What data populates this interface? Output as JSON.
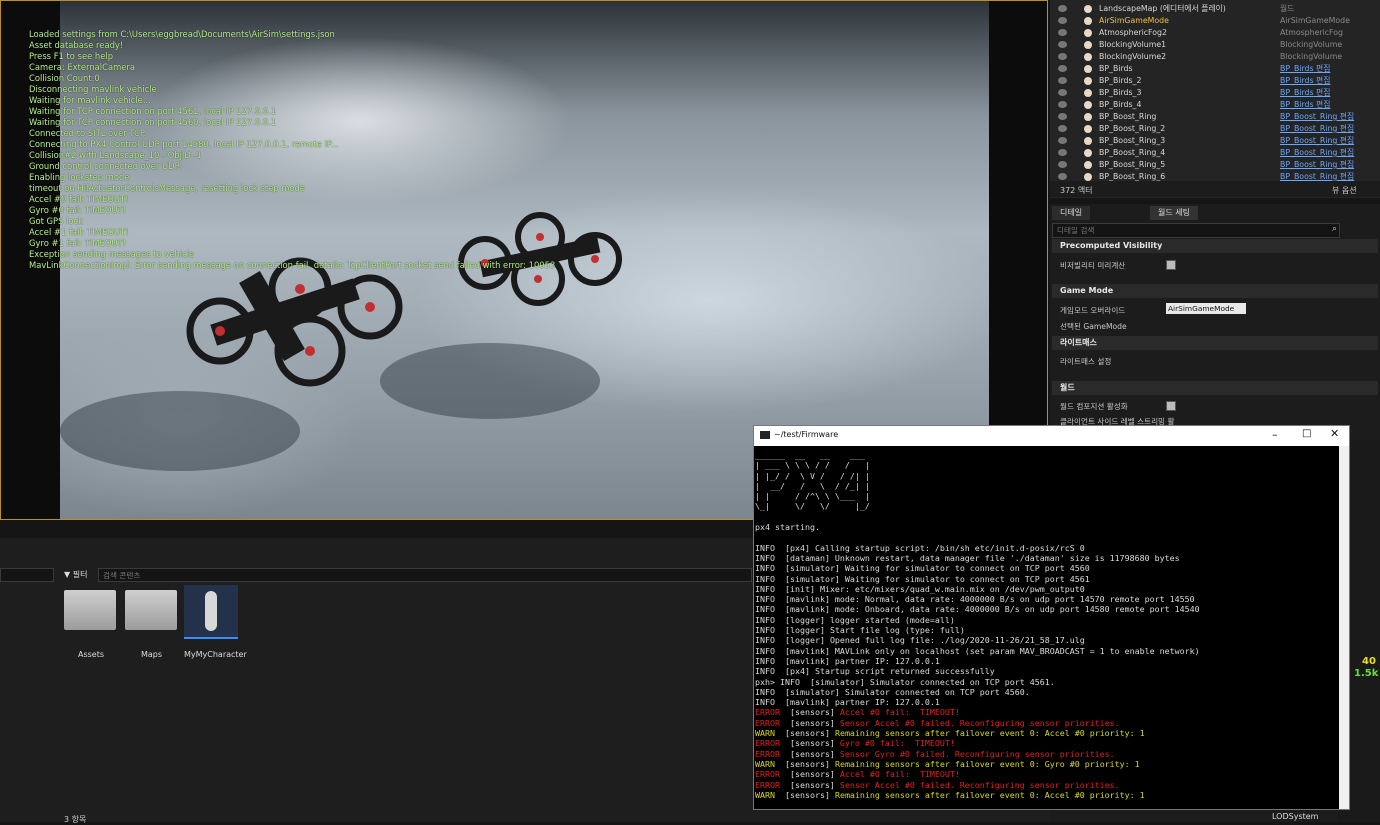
{
  "viewport": {
    "log_lines": [
      "Loaded settings from C:\\Users\\eggbread\\Documents\\AirSim\\settings.json",
      "Asset database ready!",
      "Press F1 to see help",
      "Camera: ExternalCamera",
      "Collision Count:0",
      "Disconnecting mavlink vehicle",
      "Waiting for mavlink vehicle...",
      "Waiting for TCP connection on port 4561, local IP 127.0.0.1",
      "Waiting for TCP connection on port 4560, local IP 127.0.0.1",
      "Connected to SITL over TCP.",
      "Connecting to PX4 Control UDP port 14580, local IP 127.0.0.1, remote IP...",
      "Collision#2 with Landscape_10 - ObjID -1",
      "Ground control connected over UDP.",
      "Enabling lockstep mode",
      "timeout on HilActuatorControlsMessage, resetting lock step mode",
      "Accel #0 fail:  TIMEOUT!",
      "Gyro #0 fail:  TIMEOUT!",
      "Got GPS lock",
      "Accel #1 fail:  TIMEOUT!",
      "Gyro #1 fail:  TIMEOUT!",
      "Exception sending messages to vehicle",
      "MavLinkConnectionImpl: Error sending message on connection fail, details: TcpClientPort socket send failed with error: 10053"
    ]
  },
  "outliner": {
    "rows": [
      {
        "name": "LandscapeMap (에디터에서 플레이)",
        "type": "월드",
        "link": false
      },
      {
        "name": "AirSimGameMode",
        "type": "AirSimGameMode",
        "link": false
      },
      {
        "name": "AtmosphericFog2",
        "type": "AtmosphericFog",
        "link": false
      },
      {
        "name": "BlockingVolume1",
        "type": "BlockingVolume",
        "link": false
      },
      {
        "name": "BlockingVolume2",
        "type": "BlockingVolume",
        "link": false
      },
      {
        "name": "BP_Birds",
        "type": "BP_Birds 편집",
        "link": true
      },
      {
        "name": "BP_Birds_2",
        "type": "BP_Birds 편집",
        "link": true
      },
      {
        "name": "BP_Birds_3",
        "type": "BP_Birds 편집",
        "link": true
      },
      {
        "name": "BP_Birds_4",
        "type": "BP_Birds 편집",
        "link": true
      },
      {
        "name": "BP_Boost_Ring",
        "type": "BP_Boost_Ring 편집",
        "link": true
      },
      {
        "name": "BP_Boost_Ring_2",
        "type": "BP_Boost_Ring 편집",
        "link": true
      },
      {
        "name": "BP_Boost_Ring_3",
        "type": "BP_Boost_Ring 편집",
        "link": true
      },
      {
        "name": "BP_Boost_Ring_4",
        "type": "BP_Boost_Ring 편집",
        "link": true
      },
      {
        "name": "BP_Boost_Ring_5",
        "type": "BP_Boost_Ring 편집",
        "link": true
      },
      {
        "name": "BP_Boost_Ring_6",
        "type": "BP_Boost_Ring 편집",
        "link": true
      }
    ],
    "actor_count": "372 액터",
    "view_options": "뷰 옵션"
  },
  "details": {
    "tab_details": "디테일",
    "tab_world": "월드 세팅",
    "search_placeholder": "디테일 검색",
    "sec_precomputed": "Precomputed Visibility",
    "prop_visibility": "비저빌리티 미리계산",
    "sec_gamemode": "Game Mode",
    "prop_gamemode_override": "게임모드 오버라이드",
    "gamemode_value": "AirSimGameMode",
    "prop_selected_gamemode": "선택된 GameMode",
    "sec_lightmass": "라이트매스",
    "prop_lightmass_settings": "라이트매스 설정",
    "sec_world": "월드",
    "prop_world_composition": "월드 컴포지션 활성화",
    "prop_client_streaming": "클라이언트 사이드 레벨 스트리밍 활",
    "lod_label": "LODSystem",
    "view_options": "뷰 옵션"
  },
  "content_browser": {
    "filter_label": "필터",
    "search_placeholder": "검색 콘텐츠",
    "assets": [
      "Assets",
      "Maps",
      "MyMyCharacter"
    ],
    "item_count": "3 항목"
  },
  "console": {
    "title": "~/test/Firmware",
    "banner": [
      "______  __   __    ___ ",
      "| ___ \\ \\ \\ / /   /   |",
      "| |_/ /  \\ V /   / /| |",
      "|  __/   /   \\  / /_| |",
      "| |     / /^\\ \\ \\___  |",
      "\\_|     \\/   \\/     |_/"
    ],
    "starting": "px4 starting.",
    "lines": [
      {
        "lv": "INFO",
        "cls": "ok",
        "text": "[px4] Calling startup script: /bin/sh etc/init.d-posix/rcS 0"
      },
      {
        "lv": "INFO",
        "cls": "ok",
        "text": "[dataman] Unknown restart, data manager file './dataman' size is 11798680 bytes"
      },
      {
        "lv": "INFO",
        "cls": "ok",
        "text": "[simulator] Waiting for simulator to connect on TCP port 4560"
      },
      {
        "lv": "INFO",
        "cls": "ok",
        "text": "[simulator] Waiting for simulator to connect on TCP port 4561"
      },
      {
        "lv": "INFO",
        "cls": "ok",
        "text": "[init] Mixer: etc/mixers/quad_w.main.mix on /dev/pwm_output0"
      },
      {
        "lv": "INFO",
        "cls": "ok",
        "text": "[mavlink] mode: Normal, data rate: 4000000 B/s on udp port 14570 remote port 14550"
      },
      {
        "lv": "INFO",
        "cls": "ok",
        "text": "[mavlink] mode: Onboard, data rate: 4000000 B/s on udp port 14580 remote port 14540"
      },
      {
        "lv": "INFO",
        "cls": "ok",
        "text": "[logger] logger started (mode=all)"
      },
      {
        "lv": "INFO",
        "cls": "ok",
        "text": "[logger] Start file log (type: full)"
      },
      {
        "lv": "INFO",
        "cls": "ok",
        "text": "[logger] Opened full log file: ./log/2020-11-26/21_58_17.ulg"
      },
      {
        "lv": "INFO",
        "cls": "ok",
        "text": "[mavlink] MAVLink only on localhost (set param MAV_BROADCAST = 1 to enable network)"
      },
      {
        "lv": "INFO",
        "cls": "ok",
        "text": "[mavlink] partner IP: 127.0.0.1"
      },
      {
        "lv": "INFO",
        "cls": "ok",
        "text": "[px4] Startup script returned successfully"
      },
      {
        "lv": "pxh> INFO",
        "cls": "ok",
        "text": "[simulator] Simulator connected on TCP port 4561."
      },
      {
        "lv": "INFO",
        "cls": "ok",
        "text": "[simulator] Simulator connected on TCP port 4560."
      },
      {
        "lv": "INFO",
        "cls": "ok",
        "text": "[mavlink] partner IP: 127.0.0.1"
      },
      {
        "lv": "ERROR",
        "cls": "err",
        "text": "[sensors] Accel #0 fail:  TIMEOUT!"
      },
      {
        "lv": "ERROR",
        "cls": "err",
        "text": "[sensors] Sensor Accel #0 failed. Reconfiguring sensor priorities."
      },
      {
        "lv": "WARN",
        "cls": "warn",
        "text": "[sensors] Remaining sensors after failover event 0: Accel #0 priority: 1"
      },
      {
        "lv": "ERROR",
        "cls": "err",
        "text": "[sensors] Gyro #0 fail:  TIMEOUT!"
      },
      {
        "lv": "ERROR",
        "cls": "err",
        "text": "[sensors] Sensor Gyro #0 failed. Reconfiguring sensor priorities."
      },
      {
        "lv": "WARN",
        "cls": "warn",
        "text": "[sensors] Remaining sensors after failover event 0: Gyro #0 priority: 1"
      },
      {
        "lv": "ERROR",
        "cls": "err",
        "text": "[sensors] Accel #0 fail:  TIMEOUT!"
      },
      {
        "lv": "ERROR",
        "cls": "err",
        "text": "[sensors] Sensor Accel #0 failed. Reconfiguring sensor priorities."
      },
      {
        "lv": "WARN",
        "cls": "warn",
        "text": "[sensors] Remaining sensors after failover event 0: Accel #0 priority: 1"
      }
    ]
  },
  "right_hud": {
    "top": "40",
    "bottom": "1.5k"
  },
  "colors": {
    "log_green": "#b6f08a",
    "error": "#e02020",
    "warn": "#d8d820",
    "link": "#6aa8ff",
    "viewport_border": "#b8902a"
  }
}
